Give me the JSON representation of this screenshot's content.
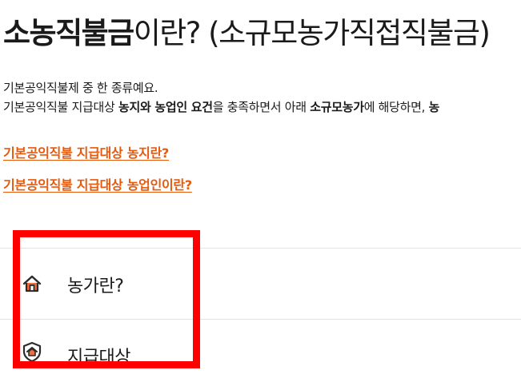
{
  "header": {
    "title_bold": "소농직불금",
    "title_rest": "이란? (소규모농가직접직불금)"
  },
  "intro": {
    "line1": "기본공익직불제 중 한 종류예요.",
    "line2_a": "기본공익직불 지급대상 ",
    "line2_b": "농지와 농업인 요건",
    "line2_c": "을 충족하면서 아래 ",
    "line2_d": "소규모농가",
    "line2_e": "에 해당하면, ",
    "line2_f": "농"
  },
  "links": [
    {
      "label": "기본공익직불 지급대상 농지란?"
    },
    {
      "label": "기본공익직불 지급대상 농업인이란?"
    }
  ],
  "menu": [
    {
      "label": "농가란?",
      "icon": "house-icon"
    },
    {
      "label": "지급대상",
      "icon": "shield-house-icon"
    }
  ],
  "colors": {
    "link": "#e8590c",
    "highlight": "#ff0000",
    "icon_outline": "#2b2b2b",
    "icon_fill": "#f26b3a"
  }
}
